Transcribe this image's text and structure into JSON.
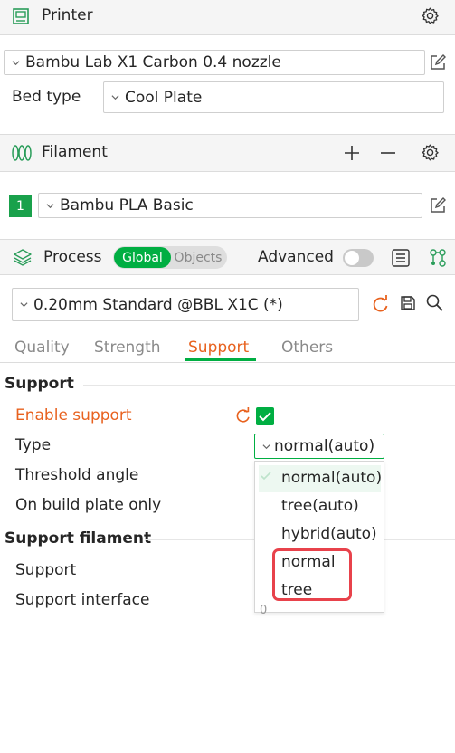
{
  "printer": {
    "title": "Printer",
    "preset": "Bambu Lab X1 Carbon 0.4 nozzle",
    "bed_type_label": "Bed type",
    "bed_type_value": "Cool Plate"
  },
  "filament": {
    "title": "Filament",
    "slot_number": "1",
    "slot_color": "#19a14b",
    "preset": "Bambu PLA Basic"
  },
  "process": {
    "title": "Process",
    "toggle_global": "Global",
    "toggle_objects": "Objects",
    "advanced_label": "Advanced",
    "preset": "0.20mm Standard @BBL X1C (*)"
  },
  "tabs": [
    {
      "label": "Quality"
    },
    {
      "label": "Strength"
    },
    {
      "label": "Support"
    },
    {
      "label": "Others"
    }
  ],
  "settings": {
    "group_support": "Support",
    "enable_support": "Enable support",
    "type_label": "Type",
    "type_value": "normal(auto)",
    "threshold_angle": "Threshold angle",
    "on_build_plate_only": "On build plate only",
    "group_support_filament": "Support filament",
    "support": "Support",
    "support_interface": "Support interface"
  },
  "type_dropdown": {
    "options": [
      "normal(auto)",
      "tree(auto)",
      "hybrid(auto)",
      "normal",
      "tree"
    ],
    "selected": "normal(auto)",
    "partial_value": "0"
  },
  "colors": {
    "accent_orange": "#e8621f",
    "accent_green": "#00ae42",
    "highlight_red": "#e8424b"
  }
}
